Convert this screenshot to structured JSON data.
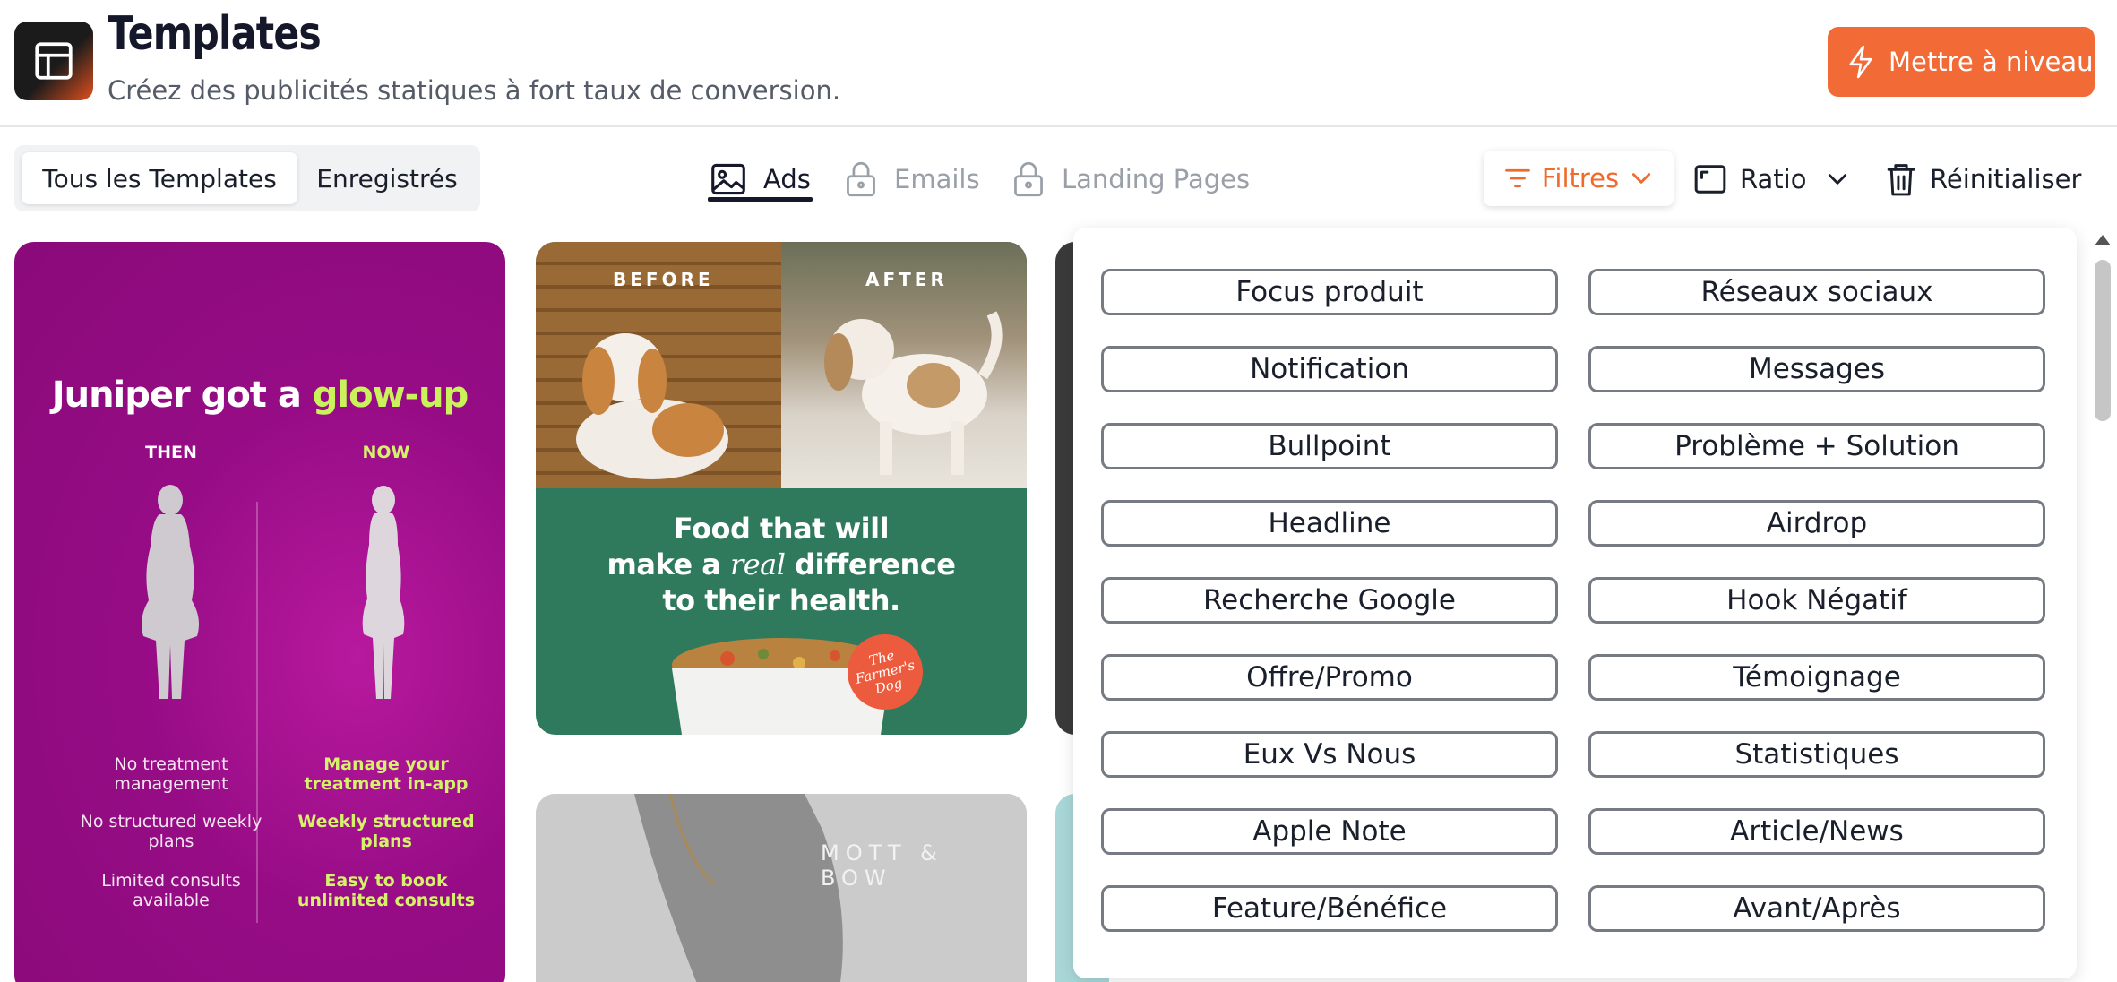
{
  "header": {
    "title": "Templates",
    "subtitle": "Créez des publicités statiques à fort taux de conversion.",
    "upgrade_label": "Mettre à niveau",
    "upgrade_color": "#f26a35"
  },
  "toolbar": {
    "segments": [
      "Tous les Templates",
      "Enregistrés"
    ],
    "active_segment": "Tous les Templates",
    "type_tabs": [
      {
        "label": "Ads",
        "icon": "image-icon",
        "locked": false,
        "active": true
      },
      {
        "label": "Emails",
        "icon": "lock-icon",
        "locked": true,
        "active": false
      },
      {
        "label": "Landing Pages",
        "icon": "lock-icon",
        "locked": true,
        "active": false
      }
    ],
    "filters_label": "Filtres",
    "filters_color": "#ef6a2c",
    "ratio_label": "Ratio",
    "reset_label": "Réinitialiser"
  },
  "filters": [
    [
      "Focus produit",
      "Réseaux sociaux"
    ],
    [
      "Notification",
      "Messages"
    ],
    [
      "Bullpoint",
      "Problème + Solution"
    ],
    [
      "Headline",
      "Airdrop"
    ],
    [
      "Recherche Google",
      "Hook Négatif"
    ],
    [
      "Offre/Promo",
      "Témoignage"
    ],
    [
      "Eux Vs Nous",
      "Statistiques"
    ],
    [
      "Apple Note",
      "Article/News"
    ],
    [
      "Feature/Bénéfice",
      "Avant/Après"
    ]
  ],
  "cards": {
    "juniper": {
      "title_prefix": "Juniper got a ",
      "title_highlight": "glow-up",
      "then_label": "THEN",
      "now_label": "NOW",
      "then_items": [
        "No treatment management",
        "No structured weekly plans",
        "Limited consults available"
      ],
      "now_items": [
        "Manage your treatment in-app",
        "Weekly structured plans",
        "Easy to book unlimited consults"
      ]
    },
    "farmers_dog": {
      "before_label": "BEFORE",
      "after_label": "AFTER",
      "line1": "Food that will",
      "line2_prefix": "make a ",
      "line2_italic": "real",
      "line2_suffix": " difference",
      "line3": "to their health.",
      "badge": "The Farmer's Dog"
    },
    "mott_bow": {
      "brand": "MOTT & BOW"
    }
  }
}
